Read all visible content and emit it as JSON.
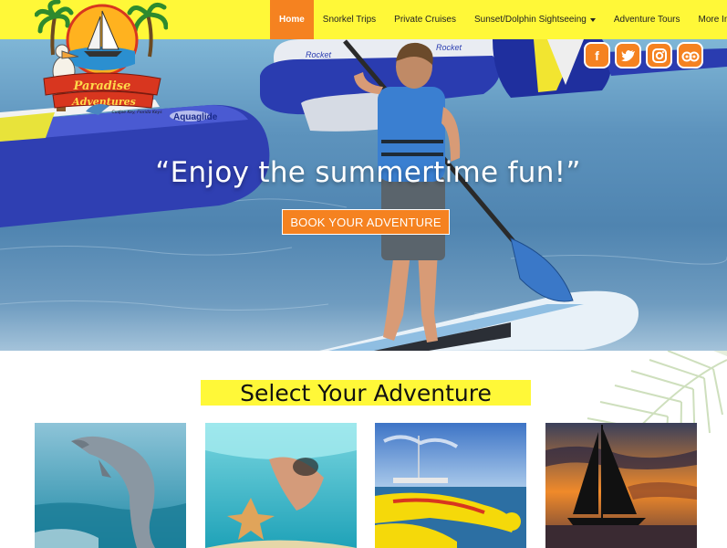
{
  "brand": {
    "logo_line1": "Paradise",
    "logo_line2": "Adventures",
    "logo_tagline": "Cudjoe Key, Florida Keys"
  },
  "nav": {
    "items": [
      {
        "label": "Home",
        "active": true,
        "dropdown": false
      },
      {
        "label": "Snorkel Trips",
        "active": false,
        "dropdown": false
      },
      {
        "label": "Private Cruises",
        "active": false,
        "dropdown": false
      },
      {
        "label": "Sunset/Dolphin Sightseeing",
        "active": false,
        "dropdown": true
      },
      {
        "label": "Adventure Tours",
        "active": false,
        "dropdown": false
      },
      {
        "label": "More Info",
        "active": false,
        "dropdown": true
      }
    ]
  },
  "social": [
    {
      "name": "facebook-icon",
      "glyph": "f"
    },
    {
      "name": "twitter-icon",
      "glyph": "t"
    },
    {
      "name": "instagram-icon",
      "glyph": "◎"
    },
    {
      "name": "tripadvisor-icon",
      "glyph": "∞"
    }
  ],
  "hero": {
    "title": "“Enjoy the summertime fun!”",
    "cta_label": "BOOK YOUR ADVENTURE",
    "float_brand": "Aquaglide",
    "float_brand2": "Rocket"
  },
  "section": {
    "title": "Select Your Adventure"
  },
  "colors": {
    "accent": "#f58220",
    "nav_bg": "#fff838",
    "water": "#4f84b0"
  }
}
